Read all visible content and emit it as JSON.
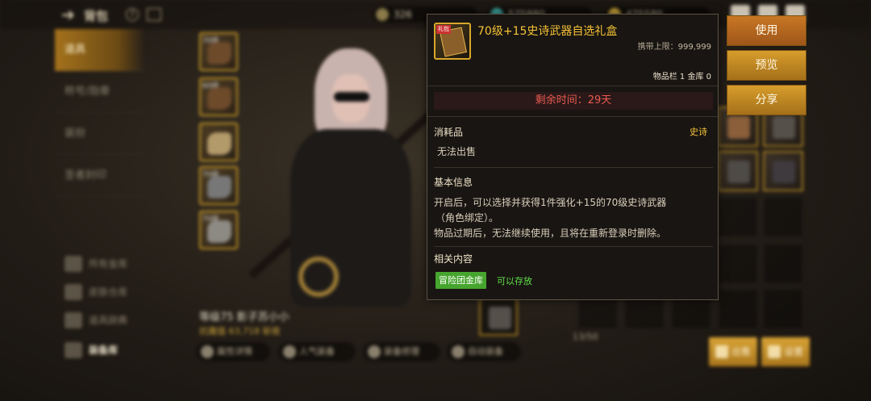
{
  "topbar": {
    "title": "背包",
    "resources": [
      {
        "value": "326",
        "icon": "fatigue-icon",
        "color": "#8a7a4a"
      },
      {
        "value": "575880",
        "icon": "gem-icon",
        "color": "#3fa6a0"
      },
      {
        "value": "475580",
        "icon": "gold-icon",
        "color": "#c9a23a"
      }
    ]
  },
  "sidebar": {
    "items": [
      {
        "label": "道具"
      },
      {
        "label": "称号/勋章"
      },
      {
        "label": "装扮"
      },
      {
        "label": "圣者封印"
      }
    ],
    "storage_links": [
      {
        "label": "所有金库",
        "icon": "vault-icon"
      },
      {
        "label": "皮肤仓库",
        "icon": "wardrobe-icon"
      },
      {
        "label": "道具辞典",
        "icon": "dictionary-icon"
      },
      {
        "label": "装备库",
        "icon": "equipment-storage-icon"
      }
    ]
  },
  "character": {
    "level_name": "等级75 影子苏小小",
    "power_label": "抗魔值",
    "power_value": "63,718",
    "power_suffix": "斩夜"
  },
  "equipment_slots": [
    {
      "level": "70级"
    },
    {
      "level": "60级"
    },
    {
      "level": ""
    },
    {
      "level": "70级"
    },
    {
      "level": "70级"
    }
  ],
  "bottom_buttons": [
    {
      "label": "属性详情"
    },
    {
      "label": "人气装备"
    },
    {
      "label": "装备修理"
    },
    {
      "label": "自动装备"
    }
  ],
  "inventory": {
    "count": "13/50",
    "sell_label": "出售",
    "settings_label": "设置"
  },
  "tooltip": {
    "title": "70级+15史诗武器自选礼盒",
    "icon_tag": "礼包",
    "carry_label": "携带上限：",
    "carry_value": "999,999",
    "stock": "物品栏 1 金库 0",
    "remaining": "剩余时间：29天",
    "category": "消耗品",
    "grade": "史诗",
    "no_sell": "无法出售",
    "basic_header": "基本信息",
    "desc_line1": "开启后，可以选择并获得1件强化+15的70级史诗武器",
    "desc_line2": "（角色绑定）。",
    "desc_line3": "物品过期后，无法继续使用，且将在重新登录时删除。",
    "related_header": "相关内容",
    "related_badge": "冒险团金库",
    "related_note": "可以存放",
    "colors": {
      "title": "#f5c236",
      "time": "#e85a50",
      "badge": "#46a52e"
    }
  },
  "actions": {
    "use": "使用",
    "preview": "预览",
    "share": "分享"
  }
}
